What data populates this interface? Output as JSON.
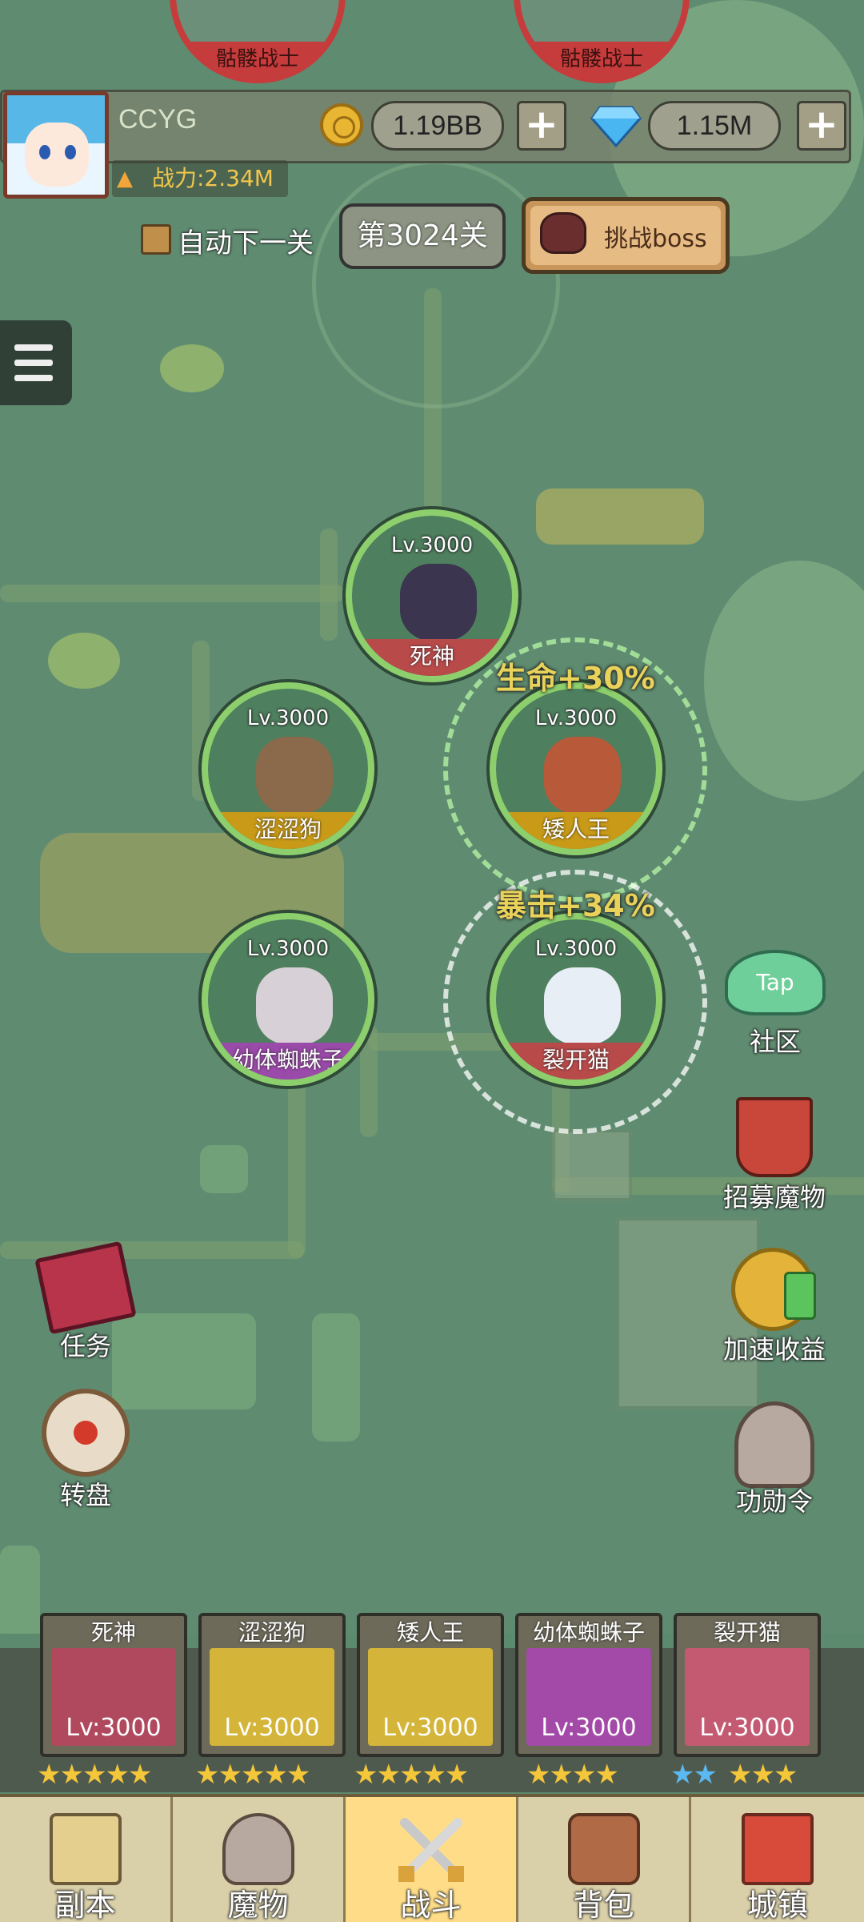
{
  "enemies": [
    {
      "name": "骷髅战士"
    },
    {
      "name": "骷髅战士"
    }
  ],
  "player": {
    "name": "CCYG",
    "power": "战力:2.34M",
    "gold": "1.19BB",
    "gems": "1.15M"
  },
  "stage": {
    "auto_next_label": "自动下一关",
    "auto_next_checked": true,
    "level": "第3024关",
    "boss_button_label": "挑战boss"
  },
  "heroes": [
    {
      "name": "死神",
      "level": "Lv.3000",
      "name_bar_color": "#b84a4a"
    },
    {
      "name": "涩涩狗",
      "level": "Lv.3000",
      "name_bar_color": "#c99a17"
    },
    {
      "name": "矮人王",
      "level": "Lv.3000",
      "name_bar_color": "#c99a17",
      "buff": "生命+30%"
    },
    {
      "name": "幼体蜘蛛子",
      "level": "Lv.3000",
      "name_bar_color": "#9a4aa8"
    },
    {
      "name": "裂开猫",
      "level": "Lv.3000",
      "name_bar_color": "#b84a4a",
      "buff": "暴击+34%"
    }
  ],
  "side_buttons": {
    "community": {
      "label": "社区",
      "icon": "tap-community-icon",
      "icon_text": "Tap"
    },
    "recruit": {
      "label": "招募魔物",
      "icon": "recruit-banner-icon"
    },
    "speed": {
      "label": "加速收益",
      "icon": "speed-coin-icon"
    },
    "merit": {
      "label": "功勋令",
      "icon": "merit-helmet-icon"
    },
    "quest": {
      "label": "任务",
      "icon": "quest-book-icon"
    },
    "wheel": {
      "label": "转盘",
      "icon": "wheel-icon"
    }
  },
  "team": [
    {
      "name": "死神",
      "level": "Lv:3000",
      "stars": "★★★★★",
      "star_color": "#f4c63a",
      "bg": "#b0495e"
    },
    {
      "name": "涩涩狗",
      "level": "Lv:3000",
      "stars": "★★★★★",
      "star_color": "#f4c63a",
      "bg": "#d4b53a"
    },
    {
      "name": "矮人王",
      "level": "Lv:3000",
      "stars": "★★★★★",
      "star_color": "#f4c63a",
      "bg": "#d4b53a"
    },
    {
      "name": "幼体蜘蛛子",
      "level": "Lv:3000",
      "stars": "★★★★",
      "star_color": "#f4c63a",
      "bg": "#a34aa8"
    },
    {
      "name": "裂开猫",
      "level": "Lv:3000",
      "stars_blue": "★★",
      "stars": "★★★",
      "star_color": "#f4c63a",
      "blue_star_color": "#5bb8f0",
      "bg": "#c45a72"
    }
  ],
  "nav": [
    {
      "label": "副本",
      "icon": "map-icon"
    },
    {
      "label": "魔物",
      "icon": "monster-helmet-icon"
    },
    {
      "label": "战斗",
      "icon": "crossed-swords-icon",
      "active": true
    },
    {
      "label": "背包",
      "icon": "backpack-icon"
    },
    {
      "label": "城镇",
      "icon": "town-shop-icon"
    }
  ],
  "colors": {
    "accent_gold": "#f1c64a",
    "enemy_ring": "#c63b3b",
    "hero_ring": "#8ccf6c",
    "active_tab": "#ffdd88"
  }
}
